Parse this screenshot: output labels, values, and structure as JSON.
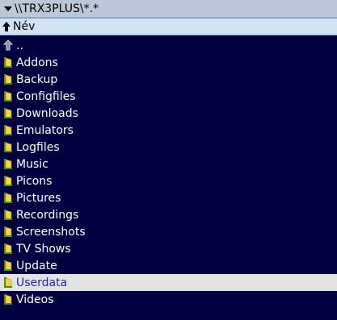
{
  "path": {
    "text": "\\\\TRX3PLUS\\*.*"
  },
  "column": {
    "name_label": "Név"
  },
  "colors": {
    "background": "#000040",
    "path_bar": "#bcc7d8",
    "header": "#d1e3f5",
    "selected_row": "#e3e3e3",
    "selected_text": "#2424a8",
    "folder_yellow": "#f5d547",
    "folder_green": "#4b8a1e"
  },
  "items": [
    {
      "label": "..",
      "icon": "up-arrow-icon",
      "selected": false
    },
    {
      "label": "Addons",
      "icon": "folder-icon",
      "selected": false
    },
    {
      "label": "Backup",
      "icon": "folder-icon",
      "selected": false
    },
    {
      "label": "Configfiles",
      "icon": "folder-icon",
      "selected": false
    },
    {
      "label": "Downloads",
      "icon": "folder-icon",
      "selected": false
    },
    {
      "label": "Emulators",
      "icon": "folder-icon",
      "selected": false
    },
    {
      "label": "Logfiles",
      "icon": "folder-icon",
      "selected": false
    },
    {
      "label": "Music",
      "icon": "folder-icon",
      "selected": false
    },
    {
      "label": "Picons",
      "icon": "folder-icon",
      "selected": false
    },
    {
      "label": "Pictures",
      "icon": "folder-icon",
      "selected": false
    },
    {
      "label": "Recordings",
      "icon": "folder-icon",
      "selected": false
    },
    {
      "label": "Screenshots",
      "icon": "folder-icon",
      "selected": false
    },
    {
      "label": "TV Shows",
      "icon": "folder-icon",
      "selected": false
    },
    {
      "label": "Update",
      "icon": "folder-icon",
      "selected": false
    },
    {
      "label": "Userdata",
      "icon": "folder-icon",
      "selected": true
    },
    {
      "label": "Videos",
      "icon": "folder-icon",
      "selected": false
    }
  ]
}
